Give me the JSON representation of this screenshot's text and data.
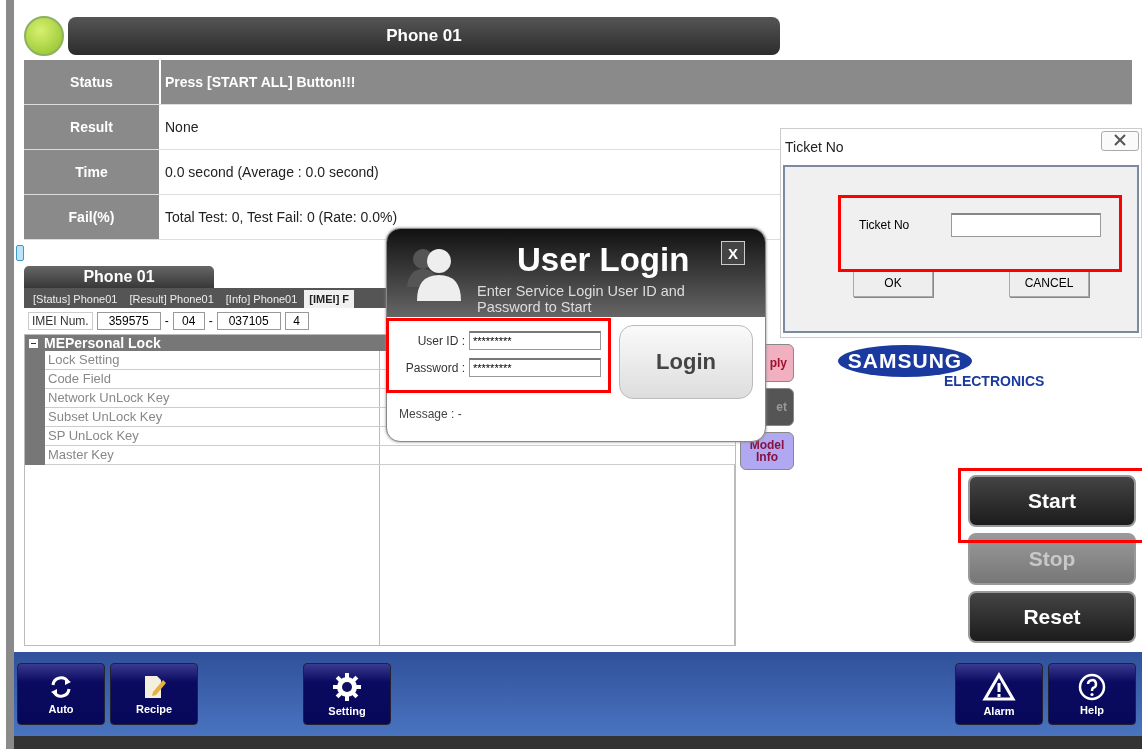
{
  "header": {
    "title": "Phone 01",
    "indicator_on": true
  },
  "info_rows": [
    {
      "label": "Status",
      "value": "Press [START ALL] Button!!!",
      "highlighted": true
    },
    {
      "label": "Result",
      "value": "None",
      "highlighted": false
    },
    {
      "label": "Time",
      "value": "0.0 second (Average : 0.0 second)",
      "highlighted": false
    },
    {
      "label": "Fail(%)",
      "value": "Total Test: 0, Test Fail: 0 (Rate: 0.0%)",
      "highlighted": false
    }
  ],
  "panel": {
    "title": "Phone 01",
    "tabs": [
      {
        "label": "[Status] Phone01",
        "selected": false
      },
      {
        "label": "[Result] Phone01",
        "selected": false
      },
      {
        "label": "[Info] Phone01",
        "selected": false
      },
      {
        "label": "[IMEI] F",
        "selected": true
      }
    ],
    "imei": {
      "label": "IMEI Num.",
      "parts": [
        "359575",
        "04",
        "037105",
        "4"
      ],
      "separators": [
        "-",
        "-"
      ]
    },
    "tree": {
      "title": "MEPersonal Lock",
      "expanded": true,
      "children": [
        {
          "label": "Lock Setting"
        },
        {
          "label": "Code Field"
        },
        {
          "label": "Network UnLock Key"
        },
        {
          "label": "Subset UnLock Key"
        },
        {
          "label": "SP UnLock Key"
        },
        {
          "label": "Master Key"
        }
      ]
    }
  },
  "side_buttons": [
    {
      "label": "ply",
      "kind": "apply"
    },
    {
      "label": "et",
      "kind": "reset"
    },
    {
      "label": "Model Info",
      "kind": "info"
    }
  ],
  "logo": {
    "name": "SAMSUNG",
    "sub": "ELECTRONICS"
  },
  "controls": [
    {
      "label": "Start",
      "disabled": false
    },
    {
      "label": "Stop",
      "disabled": true
    },
    {
      "label": "Reset",
      "disabled": false
    }
  ],
  "toolbar": [
    {
      "label": "Auto",
      "kind": "refresh"
    },
    {
      "label": "Recipe",
      "kind": "recipe"
    },
    {
      "label": "Setting",
      "kind": "gear"
    },
    {
      "label": "Alarm",
      "kind": "warning"
    },
    {
      "label": "Help",
      "kind": "help"
    }
  ],
  "login_dialog": {
    "title": "User Login",
    "subtitle": "Enter Service Login User ID and Password to Start",
    "close": "X",
    "fields": [
      {
        "label": "User ID :",
        "value": "*********"
      },
      {
        "label": "Password :",
        "value": "*********"
      }
    ],
    "button": "Login",
    "message": "Message : -"
  },
  "ticket_dialog": {
    "title": "Ticket No",
    "field_label": "Ticket No",
    "ok": "OK",
    "cancel": "CANCEL"
  }
}
